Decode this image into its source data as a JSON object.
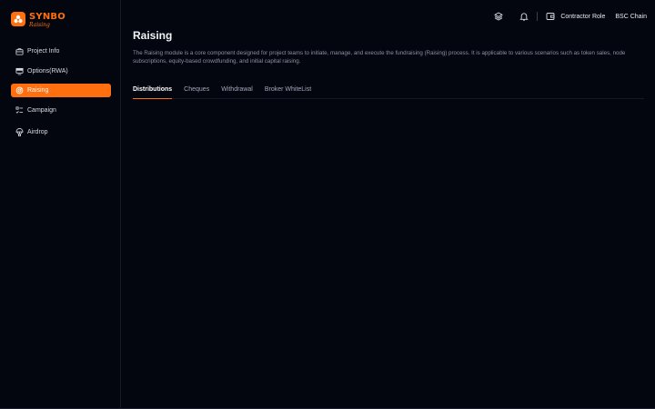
{
  "brand": {
    "name": "SYNBO",
    "subtitle": "Raising",
    "accent_color": "#ff6f0f",
    "logo_icon": "synbo-logo-icon"
  },
  "sidebar": {
    "items": [
      {
        "label": "Project Info",
        "icon": "briefcase-icon",
        "active": false
      },
      {
        "label": "Options(RWA)",
        "icon": "monitor-icon",
        "active": false
      },
      {
        "label": "Raising",
        "icon": "target-icon",
        "active": true
      },
      {
        "label": "Campaign",
        "icon": "checklist-icon",
        "active": false
      },
      {
        "label": "Airdrop",
        "icon": "parachute-icon",
        "active": false
      }
    ]
  },
  "topbar": {
    "layers_icon": "layers-icon",
    "bell_icon": "bell-icon",
    "wallet_icon": "wallet-icon",
    "role_label": "Contractor Role",
    "chain_label": "BSC Chain"
  },
  "page": {
    "title": "Raising",
    "description": "The Raising module is a core component designed for project teams to initiate, manage, and execute the fundraising (Raising) process. It is applicable to various scenarios such as token sales, node subscriptions, equity-based crowdfunding, and initial capital raising."
  },
  "tabs": [
    {
      "label": "Distributions",
      "active": true
    },
    {
      "label": "Cheques",
      "active": false
    },
    {
      "label": "Withdrawal",
      "active": false
    },
    {
      "label": "Broker WhiteList",
      "active": false
    }
  ]
}
